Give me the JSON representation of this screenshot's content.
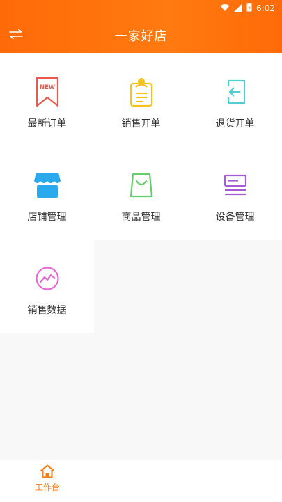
{
  "status_bar": {
    "time": "6:02"
  },
  "header": {
    "title": "一家好店",
    "swap_icon": "swap-arrows-icon"
  },
  "tiles": [
    {
      "label": "最新订单",
      "icon": "new-badge-icon",
      "badge_text": "NEW",
      "color": "#e85a4f"
    },
    {
      "label": "销售开单",
      "icon": "clipboard-person-icon",
      "color": "#f5c31b"
    },
    {
      "label": "退货开单",
      "icon": "return-door-icon",
      "color": "#4fd0d0"
    },
    {
      "label": "店铺管理",
      "icon": "store-awning-icon",
      "color": "#2aa9ec"
    },
    {
      "label": "商品管理",
      "icon": "shopping-bag-icon",
      "color": "#62cf6a"
    },
    {
      "label": "设备管理",
      "icon": "device-card-icon",
      "color": "#a45bd6"
    },
    {
      "label": "销售数据",
      "icon": "trend-circle-icon",
      "color": "#e36ad6"
    }
  ],
  "bottom_nav": {
    "items": [
      {
        "label": "工作台",
        "icon": "home-icon",
        "active": true,
        "color": "#ff7a10"
      }
    ]
  }
}
